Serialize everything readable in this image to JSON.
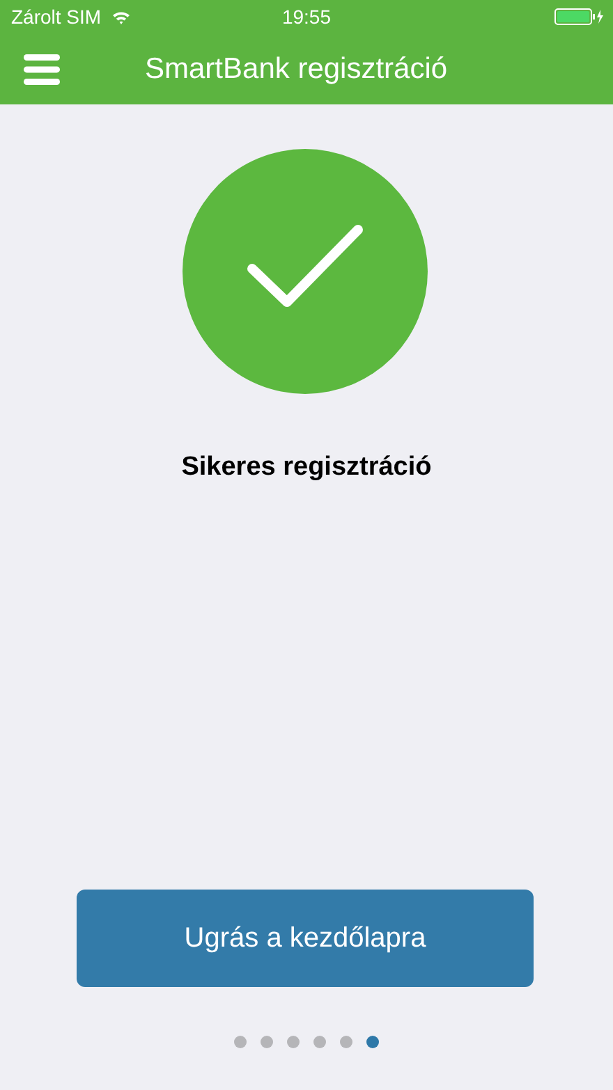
{
  "status_bar": {
    "carrier": "Zárolt SIM",
    "time": "19:55"
  },
  "nav": {
    "title": "SmartBank regisztráció"
  },
  "message": "Sikeres regisztráció",
  "button": "Ugrás a kezdőlapra",
  "pages": [
    {
      "selected": false
    },
    {
      "selected": false
    },
    {
      "selected": false
    },
    {
      "selected": false
    },
    {
      "selected": false
    },
    {
      "selected": true
    }
  ]
}
